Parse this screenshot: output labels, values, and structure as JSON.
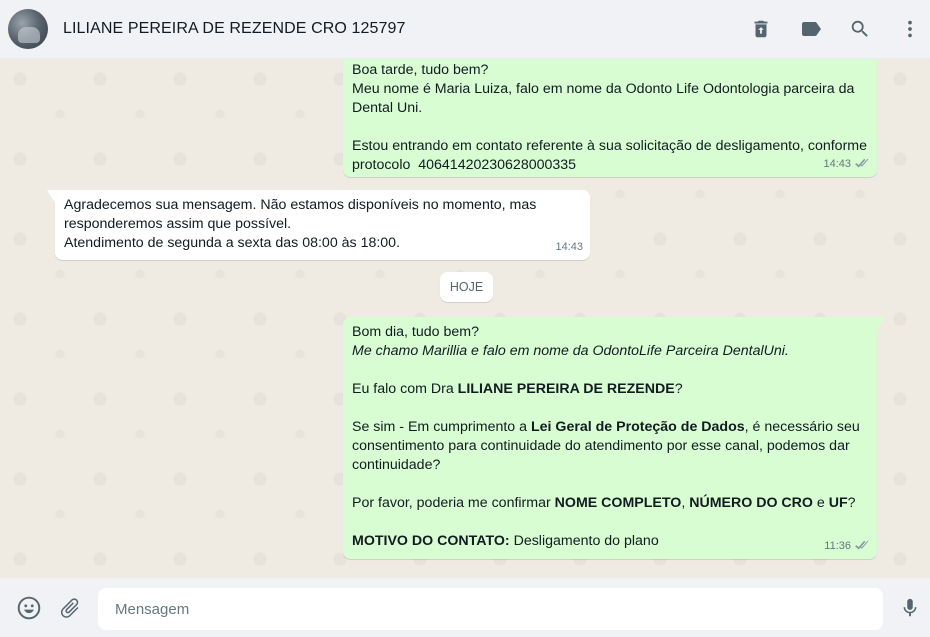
{
  "header": {
    "contact_name": "LILIANE PEREIRA DE REZENDE CRO 125797",
    "icons": [
      "avatar",
      "delete-icon",
      "label-icon",
      "search-icon",
      "menu-icon"
    ]
  },
  "messages": [
    {
      "direction": "out",
      "lines": [
        "Boa tarde, tudo bem?",
        "Meu nome é Maria Luiza, falo em nome da Odonto Life Odontologia parceira da",
        "Dental Uni.",
        "",
        "Estou entrando em contato referente à sua solicitação de desligamento, conforme",
        "protocolo  40641420230628000335"
      ],
      "time": "14:43",
      "status": "read"
    },
    {
      "direction": "in",
      "lines": [
        "Agradecemos sua mensagem. Não estamos disponíveis no momento, mas",
        "responderemos assim que possível.",
        "Atendimento de segunda a sexta das 08:00 às 18:00."
      ],
      "time": "14:43"
    },
    {
      "direction": "out",
      "line1": "Bom dia, tudo bem?",
      "line2": "Me chamo Marillia e falo em nome da OdontoLife Parceira DentalUni.",
      "line3_pre": "Eu falo com Dra ",
      "line3_bold": "LILIANE PEREIRA DE REZENDE",
      "line3_post": "?",
      "line4_pre": "Se sim - Em cumprimento a ",
      "line4_bold": "Lei Geral de Proteção de Dados",
      "line4_post": ", é necessário seu",
      "line5": "consentimento para continuidade do atendimento por esse canal, podemos dar",
      "line6": "continuidade?",
      "line7_pre": "Por favor, poderia me confirmar ",
      "line7_b1": "NOME COMPLETO",
      "line7_sep1": ", ",
      "line7_b2": "NÚMERO DO CRO",
      "line7_sep2": " e ",
      "line7_b3": "UF",
      "line7_post": "?",
      "line8_bold": "MOTIVO DO CONTATO:",
      "line8_post": " Desligamento do plano",
      "time": "11:36",
      "status": "read"
    }
  ],
  "day_separator": "HOJE",
  "footer": {
    "placeholder": "Mensagem",
    "icons": [
      "emoji-icon",
      "attach-icon",
      "microphone-icon"
    ]
  },
  "colors": {
    "outgoing_bubble": "#d9fdd3",
    "incoming_bubble": "#ffffff",
    "chat_background": "#efeae2",
    "bar_background": "#f0f2f5",
    "read_ticks": "#8696a0"
  }
}
